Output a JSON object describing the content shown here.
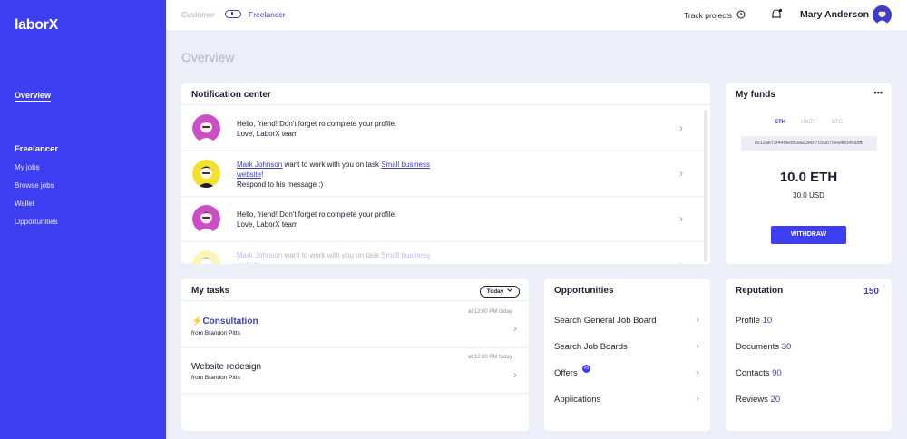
{
  "sidebar": {
    "logo": "laborX",
    "overview": "Overview",
    "section": "Freelancer",
    "items": [
      "My jobs",
      "Browse jobs",
      "Wallet",
      "Opportunities"
    ]
  },
  "topbar": {
    "customer": "Customer",
    "freelancer": "Freelancer",
    "track": "Track projects",
    "user": "Mary Anderson"
  },
  "page": {
    "title": "Overview"
  },
  "notifications": {
    "title": "Notification center",
    "n1": {
      "line1": "Hello, friend! Don't forget ro complete your profile.",
      "line2": "Love, LaborX team"
    },
    "n2": {
      "name": "Mark Johnson",
      "mid": " want to work with you on task ",
      "task1": "Small business",
      "task2": "website",
      "end": "!",
      "line3": "Respond to his message :)"
    },
    "n3": {
      "line1": "Hello, friend! Don't forget ro complete your profile.",
      "line2": "Love, LaborX team"
    },
    "n4": {
      "name": "Mark Johnson",
      "mid": " want to work with you on task ",
      "task1": "Small business",
      "task2": "website"
    }
  },
  "funds": {
    "title": "My funds",
    "menu": "•••",
    "currencies": [
      "ETH",
      "USDT",
      "BTC"
    ],
    "address": "0x12ae72f44f9ebfcaa23ebf703b079ea480459dfb",
    "balance": "10.0 ETH",
    "usd": "30.0 USD",
    "withdraw": "WITHDRAW"
  },
  "tasks": {
    "title": "My tasks",
    "filter": "Today",
    "t1": {
      "title": "Consultation",
      "from": "from Brandon Pitts",
      "time": "at 12:00 PM today"
    },
    "t2": {
      "title": "Website redesign",
      "from": "from Brandon Pitts",
      "time": "at 12:00 PM today"
    }
  },
  "opportunities": {
    "title": "Opportunities",
    "items": [
      "Search General Job Board",
      "Search Job Boards",
      "Offers",
      "Applications"
    ],
    "offers_badge": "+5"
  },
  "reputation": {
    "title": "Reputation",
    "total": "150",
    "items": [
      {
        "label": "Profile",
        "value": "10"
      },
      {
        "label": "Documents",
        "value": "30"
      },
      {
        "label": "Contacts",
        "value": "90"
      },
      {
        "label": "Reviews",
        "value": "20"
      }
    ]
  },
  "colors": {
    "accent": "#3d3df2",
    "link": "#3b3fb8",
    "background": "#eceff7"
  }
}
